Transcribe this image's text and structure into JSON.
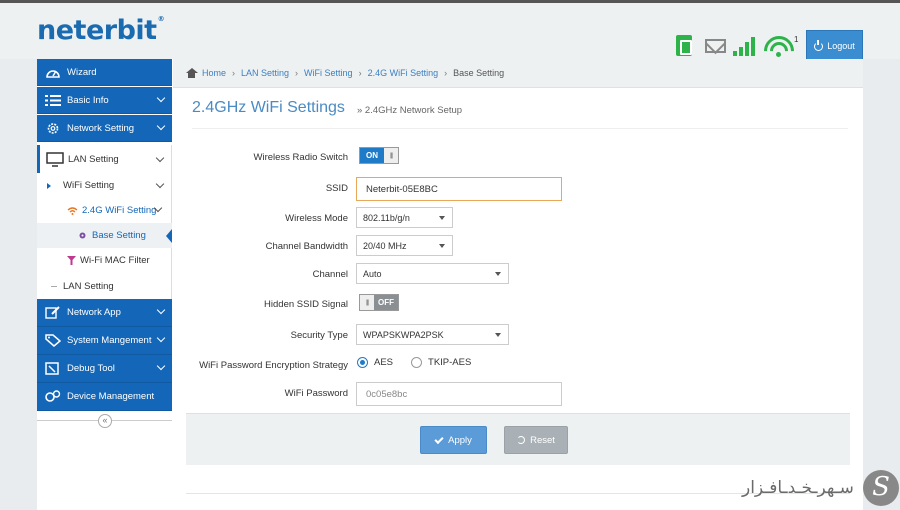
{
  "header": {
    "logo": "neterbit",
    "logo_mark": "®",
    "wifi_count": "1",
    "logout_label": "Logout",
    "accent_color": "#1467b8",
    "status_color": "#2db34a"
  },
  "sidebar": {
    "wizard": "Wizard",
    "basic_info": "Basic Info",
    "network_setting": "Network Setting",
    "lan_setting": "LAN Setting",
    "wifi_setting": "WiFi Setting",
    "wifi_24g": "2.4G WiFi Setting",
    "base_setting": "Base Setting",
    "mac_filter": "Wi-Fi MAC Filter",
    "lan_setting_sub": "LAN Setting",
    "network_app": "Network App",
    "system_management": "System Mangement",
    "debug_tool": "Debug Tool",
    "device_management": "Device Management",
    "collapse_glyph": "«"
  },
  "breadcrumb": {
    "home": "Home",
    "lan": "LAN Setting",
    "wifi": "WiFi Setting",
    "wifi24": "2.4G WiFi Setting",
    "current": "Base Setting",
    "sep": "›"
  },
  "page": {
    "title": "2.4GHz WiFi Settings",
    "subtitle": "» 2.4GHz Network Setup"
  },
  "form": {
    "radio_switch": {
      "label": "Wireless Radio Switch",
      "value": "ON"
    },
    "ssid": {
      "label": "SSID",
      "value": "Neterbit-05E8BC"
    },
    "mode": {
      "label": "Wireless Mode",
      "value": "802.11b/g/n"
    },
    "bandwidth": {
      "label": "Channel Bandwidth",
      "value": "20/40 MHz"
    },
    "channel": {
      "label": "Channel",
      "value": "Auto"
    },
    "hidden_ssid": {
      "label": "Hidden SSID Signal",
      "value": "OFF"
    },
    "security": {
      "label": "Security Type",
      "value": "WPAPSKWPA2PSK"
    },
    "encryption": {
      "label": "WiFi Password Encryption Strategy",
      "option_aes": "AES",
      "option_tkip": "TKIP-AES",
      "selected": "AES"
    },
    "password": {
      "label": "WiFi Password",
      "placeholder": "0c05e8bc"
    }
  },
  "actions": {
    "apply": "Apply",
    "reset": "Reset"
  },
  "watermark": {
    "text": "سـهرـخـدـافـزار",
    "logo": "S"
  }
}
